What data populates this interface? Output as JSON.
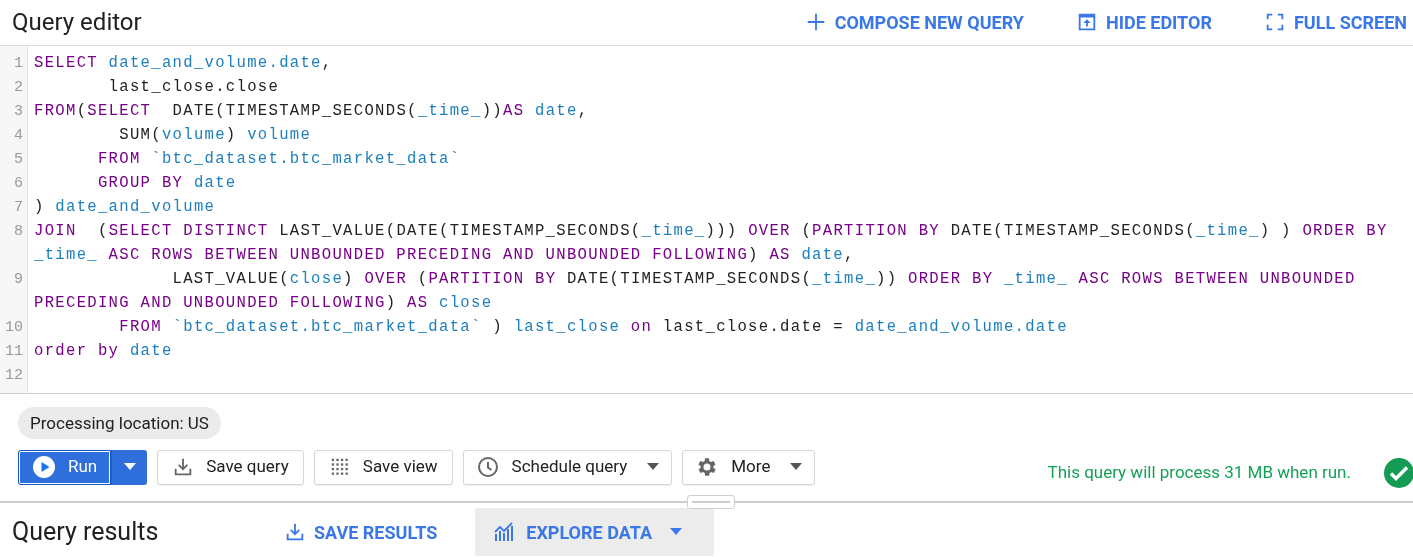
{
  "header": {
    "title": "Query editor",
    "actions": [
      {
        "label": "COMPOSE NEW QUERY"
      },
      {
        "label": "HIDE EDITOR"
      },
      {
        "label": "FULL SCREEN"
      }
    ]
  },
  "editor": {
    "lines": [
      {
        "number": "1",
        "rows": [
          {
            "tokens": [
              {
                "kind": "kw",
                "text": "SELECT"
              },
              {
                "kind": "id",
                "text": " date_and_volume.date"
              },
              {
                "kind": "txt",
                "text": ","
              }
            ]
          }
        ]
      },
      {
        "number": "2",
        "rows": [
          {
            "tokens": [
              {
                "kind": "txt",
                "text": "       last_close.close"
              }
            ]
          }
        ]
      },
      {
        "number": "3",
        "rows": [
          {
            "tokens": [
              {
                "kind": "kw",
                "text": "FROM"
              },
              {
                "kind": "txt",
                "text": "("
              },
              {
                "kind": "kw",
                "text": "SELECT"
              },
              {
                "kind": "txt",
                "text": "  DATE(TIMESTAMP_SECONDS("
              },
              {
                "kind": "id",
                "text": "_time_"
              },
              {
                "kind": "txt",
                "text": "))"
              },
              {
                "kind": "kw",
                "text": "AS"
              },
              {
                "kind": "id",
                "text": " date"
              },
              {
                "kind": "txt",
                "text": ","
              }
            ]
          }
        ]
      },
      {
        "number": "4",
        "rows": [
          {
            "tokens": [
              {
                "kind": "txt",
                "text": "        SUM("
              },
              {
                "kind": "id",
                "text": "volume"
              },
              {
                "kind": "txt",
                "text": ") "
              },
              {
                "kind": "id",
                "text": "volume"
              }
            ]
          }
        ]
      },
      {
        "number": "5",
        "rows": [
          {
            "tokens": [
              {
                "kind": "kw",
                "text": "      FROM"
              },
              {
                "kind": "id",
                "text": " `btc_dataset.btc_market_data`"
              }
            ]
          }
        ]
      },
      {
        "number": "6",
        "rows": [
          {
            "tokens": [
              {
                "kind": "kw",
                "text": "      GROUP BY"
              },
              {
                "kind": "id",
                "text": " date"
              }
            ]
          }
        ]
      },
      {
        "number": "7",
        "rows": [
          {
            "tokens": [
              {
                "kind": "txt",
                "text": ") "
              },
              {
                "kind": "id",
                "text": "date_and_volume"
              }
            ]
          }
        ]
      },
      {
        "number": "8",
        "rows": [
          {
            "tokens": [
              {
                "kind": "kw",
                "text": "JOIN"
              },
              {
                "kind": "txt",
                "text": "  ("
              },
              {
                "kind": "kw",
                "text": "SELECT DISTINCT"
              },
              {
                "kind": "txt",
                "text": " LAST_VALUE(DATE(TIMESTAMP_SECONDS("
              },
              {
                "kind": "id",
                "text": "_time_"
              },
              {
                "kind": "txt",
                "text": "))) "
              },
              {
                "kind": "kw",
                "text": "OVER"
              },
              {
                "kind": "txt",
                "text": " ("
              },
              {
                "kind": "kw",
                "text": "PARTITION BY"
              },
              {
                "kind": "txt",
                "text": " DATE(TIMESTAMP_SECONDS("
              },
              {
                "kind": "id",
                "text": "_time_"
              },
              {
                "kind": "txt",
                "text": ") ) "
              },
              {
                "kind": "kw",
                "text": "ORDER BY"
              }
            ]
          },
          {
            "tokens": [
              {
                "kind": "id",
                "text": "_time_"
              },
              {
                "kind": "kw",
                "text": " ASC ROWS BETWEEN UNBOUNDED PRECEDING AND UNBOUNDED FOLLOWING"
              },
              {
                "kind": "txt",
                "text": ") "
              },
              {
                "kind": "kw",
                "text": "AS"
              },
              {
                "kind": "id",
                "text": " date"
              },
              {
                "kind": "txt",
                "text": ","
              }
            ]
          }
        ]
      },
      {
        "number": "9",
        "rows": [
          {
            "tokens": [
              {
                "kind": "txt",
                "text": "             LAST_VALUE("
              },
              {
                "kind": "id",
                "text": "close"
              },
              {
                "kind": "txt",
                "text": ") "
              },
              {
                "kind": "kw",
                "text": "OVER"
              },
              {
                "kind": "txt",
                "text": " ("
              },
              {
                "kind": "kw",
                "text": "PARTITION BY"
              },
              {
                "kind": "txt",
                "text": " DATE(TIMESTAMP_SECONDS("
              },
              {
                "kind": "id",
                "text": "_time_"
              },
              {
                "kind": "txt",
                "text": ")) "
              },
              {
                "kind": "kw",
                "text": "ORDER BY"
              },
              {
                "kind": "id",
                "text": " _time_"
              },
              {
                "kind": "kw",
                "text": " ASC ROWS BETWEEN UNBOUNDED"
              }
            ]
          },
          {
            "tokens": [
              {
                "kind": "kw",
                "text": "PRECEDING AND UNBOUNDED FOLLOWING"
              },
              {
                "kind": "txt",
                "text": ") "
              },
              {
                "kind": "kw",
                "text": "AS"
              },
              {
                "kind": "id",
                "text": " close"
              }
            ]
          }
        ]
      },
      {
        "number": "10",
        "rows": [
          {
            "tokens": [
              {
                "kind": "kw",
                "text": "        FROM"
              },
              {
                "kind": "id",
                "text": " `btc_dataset.btc_market_data`"
              },
              {
                "kind": "txt",
                "text": " ) "
              },
              {
                "kind": "id",
                "text": "last_close"
              },
              {
                "kind": "kw",
                "text": " on"
              },
              {
                "kind": "txt",
                "text": " last_close.date = "
              },
              {
                "kind": "id",
                "text": "date_and_volume.date"
              }
            ]
          }
        ]
      },
      {
        "number": "11",
        "rows": [
          {
            "tokens": [
              {
                "kind": "kw",
                "text": "order by"
              },
              {
                "kind": "id",
                "text": " date"
              }
            ]
          }
        ]
      },
      {
        "number": "12",
        "rows": [
          {
            "tokens": []
          }
        ]
      }
    ]
  },
  "location_chip": "Processing location: US",
  "toolbar": [
    {
      "kind": "run",
      "label": "Run"
    },
    {
      "kind": "button",
      "label": "Save query"
    },
    {
      "kind": "button",
      "label": "Save view"
    },
    {
      "kind": "dropdown",
      "label": "Schedule query"
    },
    {
      "kind": "dropdown",
      "label": "More"
    }
  ],
  "validation": {
    "message": "This query will process 31 MB when run.",
    "valid": true
  },
  "results": {
    "title": "Query results",
    "actions": [
      {
        "kind": "link",
        "label": "SAVE RESULTS"
      },
      {
        "kind": "dropdown",
        "label": "EXPLORE DATA"
      }
    ]
  }
}
